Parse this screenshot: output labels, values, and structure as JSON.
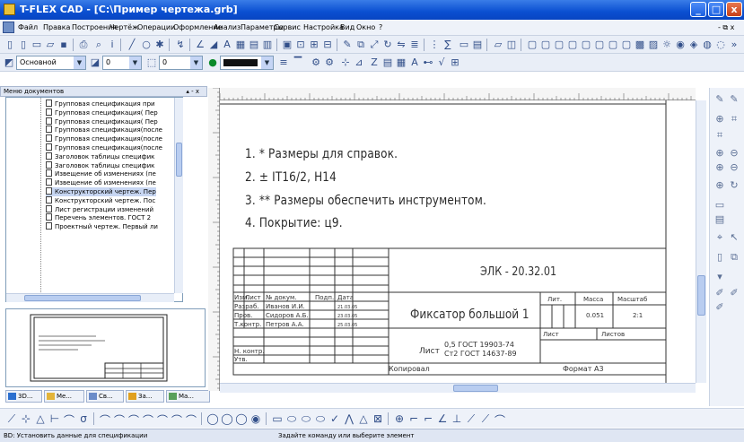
{
  "window": {
    "title": "T-FLEX CAD - [C:\\Пример чертежа.grb]",
    "min": "_",
    "max": "□",
    "close": "x"
  },
  "menu": [
    "Файл",
    "Правка",
    "Построения",
    "Чертёж",
    "Операции",
    "Оформление",
    "Анализ",
    "Параметры",
    "Сервис",
    "Настройка",
    "Вид",
    "Окно",
    "?"
  ],
  "menu_right": "- ⧉ x",
  "toolbar2": {
    "style_value": "Основной",
    "layer_value": "0",
    "num_value": "0"
  },
  "doc_panel": {
    "title": "Меню документов",
    "controls": "▴ - x",
    "items": [
      "Групповая спецификация при",
      "Групповая спецификация( Пер",
      "Групповая спецификация( Пер",
      "Групповая спецификация(после",
      "Групповая спецификация(после",
      "Групповая спецификация(после",
      "Заголовок таблицы специфик",
      "Заголовок таблицы специфик",
      "Извещение об изменениях (пе",
      "Извещение об изменениях (пе",
      "Конструкторский чертеж. Пер",
      "Конструкторский чертеж. Пос",
      "Лист регистрации изменений",
      "Перечень элементов. ГОСТ 2",
      "Проектный чертеж. Первый ли"
    ],
    "selected_index": 10
  },
  "tabs": [
    "3D...",
    "Ме...",
    "Св...",
    "За...",
    "Ма..."
  ],
  "drawing": {
    "notes": [
      "1.   * Размеры для справок.",
      "2.   ± IT16/2, H14",
      "3.   ** Размеры обеспечить инструментом.",
      "4.   Покрытие: ц9."
    ],
    "doc_code": "ЭЛК - 20.32.01",
    "part_name": "Фиксатор большой 1",
    "hdr_lit": "Лит.",
    "hdr_mass": "Масса",
    "hdr_scale": "Масштаб",
    "mass": "0.051",
    "scale": "2:1",
    "sheet_label": "Лист",
    "sheets_label": "Листов",
    "row_headers": [
      "Изм.",
      "Лист",
      "№ докум.",
      "Подп.",
      "Дата"
    ],
    "rows": [
      {
        "role": "Разраб.",
        "name": "Иванов И.И.",
        "date": "21.03.05"
      },
      {
        "role": "Пров.",
        "name": "Сидоров А.Б.",
        "date": "23.03.05"
      },
      {
        "role": "Т.контр.",
        "name": "Петров А.А.",
        "date": "25.03.05"
      }
    ],
    "n_control": "Н. контр.",
    "approved": "Утв.",
    "material_prefix": "Лист",
    "material_line1": "0,5 ГОСТ 19903-74",
    "material_line2": "Ст2 ГОСТ 14637-89",
    "copied": "Копировал",
    "format": "Формат  А3"
  },
  "status": {
    "left": "ВD: Установить данные для спецификации",
    "center": "Задайте команду или выберите элемент"
  }
}
